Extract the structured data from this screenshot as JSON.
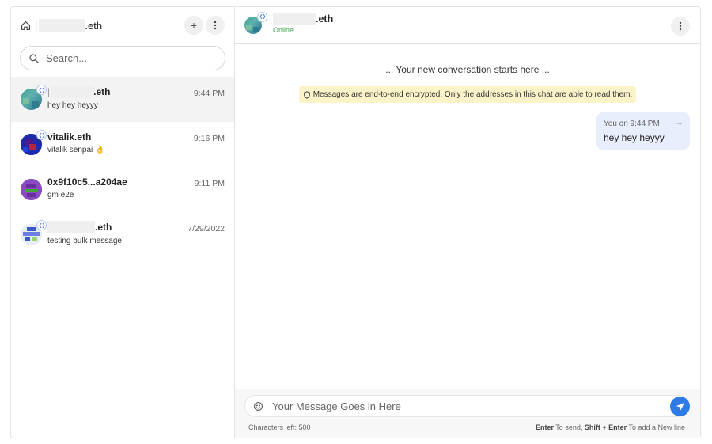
{
  "sidebar": {
    "user": {
      "name_suffix": ".eth"
    },
    "new_chat_icon": "+",
    "search": {
      "placeholder": "Search..."
    },
    "conversations": [
      {
        "name_suffix": ".eth",
        "snippet": "hey hey heyyy",
        "time": "9:44 PM",
        "active": true
      },
      {
        "name": "vitalik.eth",
        "snippet": "vitalik senpai 👌",
        "time": "9:16 PM"
      },
      {
        "name": "0x9f10c5...a204ae",
        "snippet": "gm e2e",
        "time": "9:11 PM"
      },
      {
        "name_suffix": ".eth",
        "snippet": "testing bulk message!",
        "time": "7/29/2022"
      }
    ]
  },
  "chat": {
    "header": {
      "name_suffix": ".eth",
      "status": "Online"
    },
    "start_note": "... Your new conversation starts here ...",
    "encryption_note": "Messages are end-to-end encrypted. Only the addresses in this chat are able to read them.",
    "messages": [
      {
        "meta": "You on 9:44 PM",
        "text": "hey hey heyyy",
        "more": "···"
      }
    ],
    "composer": {
      "placeholder": "Your Message Goes in Here",
      "chars_left": "Characters left: 500",
      "hint_enter": "Enter",
      "hint_send": " To send, ",
      "hint_shift": "Shift + Enter",
      "hint_newline": " To add a New line"
    }
  },
  "colors": {
    "accent": "#2f7be5",
    "online": "#3aa24a",
    "notice_bg": "#fdf3c9",
    "bubble_bg": "#e9eefc"
  }
}
